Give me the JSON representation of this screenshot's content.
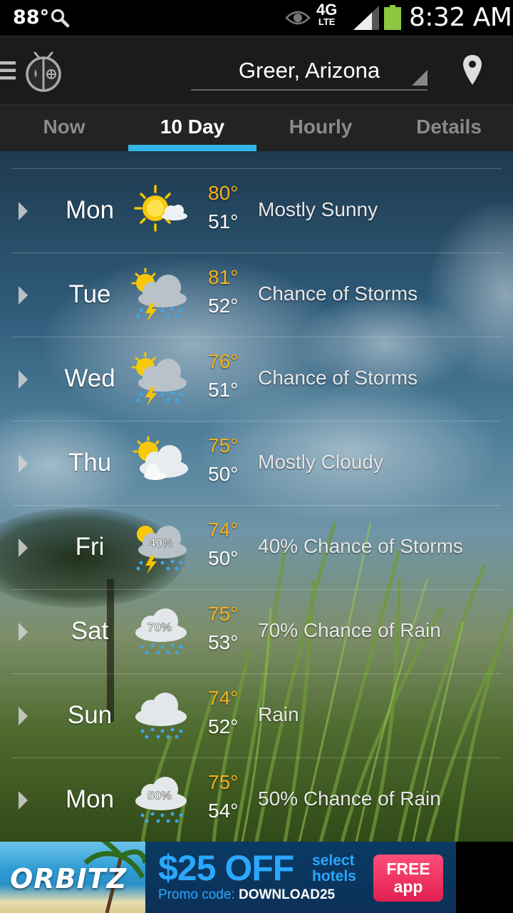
{
  "status_bar": {
    "temperature": "88°",
    "network": "4G",
    "network_sub": "LTE",
    "time": "8:32 AM",
    "icons": [
      "search-icon",
      "eye-icon",
      "signal-icon",
      "battery-icon"
    ]
  },
  "header": {
    "location": "Greer, Arizona",
    "icons": [
      "menu-icon",
      "weatherbug-logo-icon",
      "location-pin-icon"
    ]
  },
  "tabs": [
    {
      "label": "Now"
    },
    {
      "label": "10 Day",
      "active": true
    },
    {
      "label": "Hourly"
    },
    {
      "label": "Details"
    }
  ],
  "forecast": [
    {
      "day": "Mon",
      "icon": "mostly-sunny-icon",
      "high": "80°",
      "low": "51°",
      "condition": "Mostly Sunny"
    },
    {
      "day": "Tue",
      "icon": "chance-storms-icon",
      "high": "81°",
      "low": "52°",
      "condition": "Chance of Storms"
    },
    {
      "day": "Wed",
      "icon": "chance-storms-icon",
      "high": "76°",
      "low": "51°",
      "condition": "Chance of Storms"
    },
    {
      "day": "Thu",
      "icon": "mostly-cloudy-icon",
      "high": "75°",
      "low": "50°",
      "condition": "Mostly Cloudy"
    },
    {
      "day": "Fri",
      "icon": "storms-percent-icon",
      "badge": "40%",
      "high": "74°",
      "low": "50°",
      "condition": "40% Chance of Storms"
    },
    {
      "day": "Sat",
      "icon": "rain-percent-icon",
      "badge": "70%",
      "high": "75°",
      "low": "53°",
      "condition": "70% Chance of Rain"
    },
    {
      "day": "Sun",
      "icon": "rain-icon",
      "high": "74°",
      "low": "52°",
      "condition": "Rain"
    },
    {
      "day": "Mon",
      "icon": "rain-percent-icon",
      "badge": "50%",
      "high": "75°",
      "low": "54°",
      "condition": "50% Chance of Rain"
    }
  ],
  "ad": {
    "brand": "ORBITZ",
    "price": "$25 OFF",
    "select_line1": "select",
    "select_line2": "hotels",
    "promo_label": "Promo code: ",
    "promo_code": "DOWNLOAD25",
    "cta_line1": "FREE",
    "cta_line2": "app"
  },
  "colors": {
    "accent": "#33b5e5",
    "high_temp": "#f6b21e",
    "battery": "#8dc63f"
  }
}
